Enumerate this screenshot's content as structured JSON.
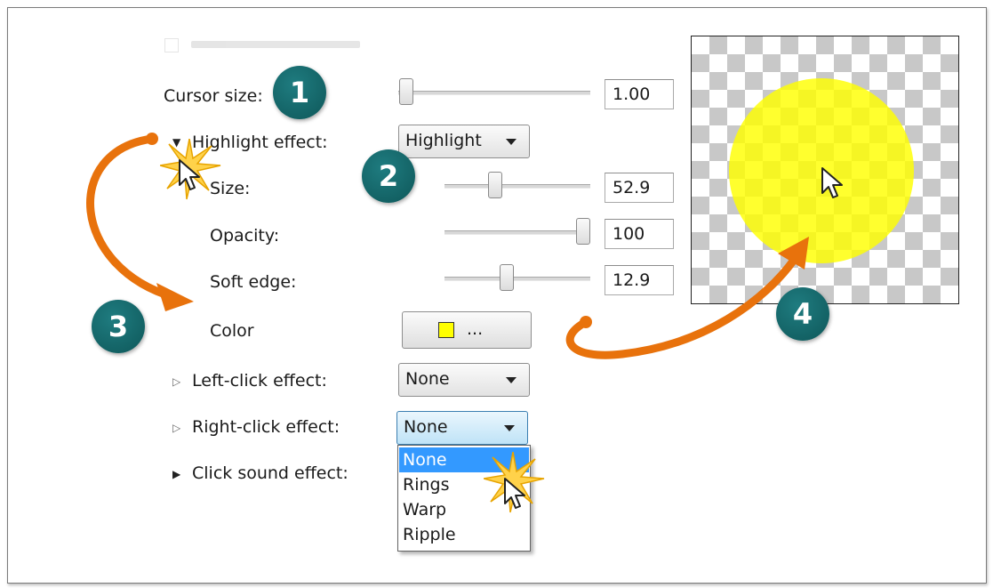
{
  "fields": {
    "cursor_size": {
      "label": "Cursor size:",
      "value": "1.00",
      "slider_level": 0.0
    },
    "highlight_effect": {
      "label": "Highlight effect:",
      "value": "Highlight"
    },
    "size": {
      "label": "Size:",
      "value": "52.9",
      "slider_level": 0.35
    },
    "opacity": {
      "label": "Opacity:",
      "value": "100",
      "slider_level": 1.0
    },
    "soft_edge": {
      "label": "Soft edge:",
      "value": "12.9",
      "slider_level": 0.43
    },
    "color": {
      "label": "Color",
      "button_text": "...",
      "swatch_color": "#ffff00"
    },
    "left_click_effect": {
      "label": "Left-click effect:",
      "value": "None"
    },
    "right_click_effect": {
      "label": "Right-click effect:",
      "value": "None"
    },
    "click_sound_effect": {
      "label": "Click sound effect:"
    }
  },
  "dropdown": {
    "options": [
      "None",
      "Rings",
      "Warp",
      "Ripple"
    ],
    "selected": "None"
  },
  "callouts": [
    "1",
    "2",
    "3",
    "4"
  ],
  "colors": {
    "callout_badge": "#146b6e",
    "arrow": "#e8720c",
    "highlight": "#ffff00",
    "selection": "#3399ff"
  },
  "icons": {
    "expanded": "triangle-down-icon",
    "collapsed": "triangle-right-icon",
    "cursor": "mouse-pointer-icon",
    "click_burst": "click-burst-icon"
  }
}
